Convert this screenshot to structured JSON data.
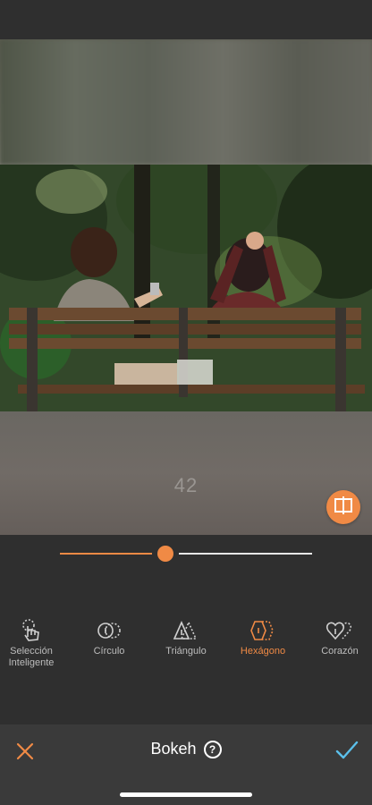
{
  "editor": {
    "effect_value": "42",
    "slider": {
      "value": 42,
      "max": 100,
      "color": "#f08a45",
      "track_color": "#e8e8e8"
    },
    "compare_icon": "compare-split-icon"
  },
  "shapes": [
    {
      "label": "Selección\nInteligente",
      "icon": "hand-select-icon",
      "active": false
    },
    {
      "label": "Círculo",
      "icon": "circle-shape-icon",
      "active": false
    },
    {
      "label": "Triángulo",
      "icon": "triangle-shape-icon",
      "active": false
    },
    {
      "label": "Hexágono",
      "icon": "hexagon-shape-icon",
      "active": true
    },
    {
      "label": "Corazón",
      "icon": "heart-shape-icon",
      "active": false
    }
  ],
  "bottom_bar": {
    "title": "Bokeh",
    "cancel_icon": "close-icon",
    "confirm_icon": "checkmark-icon",
    "help_icon": "help-icon"
  },
  "colors": {
    "accent": "#f08a45",
    "confirm": "#5bc0eb"
  }
}
